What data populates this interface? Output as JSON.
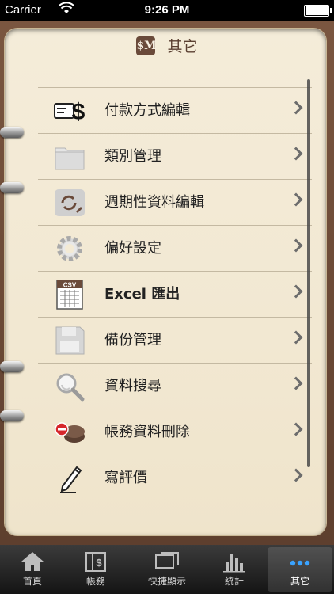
{
  "status_bar": {
    "carrier": "Carrier",
    "time": "9:26 PM"
  },
  "header": {
    "app_icon_text": "$M",
    "title": "其它"
  },
  "menu_items": [
    {
      "label": "付款方式編輯",
      "icon": "payment-method-icon"
    },
    {
      "label": "類別管理",
      "icon": "folder-icon"
    },
    {
      "label": "週期性資料編輯",
      "icon": "recurring-edit-icon"
    },
    {
      "label": "偏好設定",
      "icon": "gear-icon"
    },
    {
      "label": "Excel 匯出",
      "icon": "csv-export-icon"
    },
    {
      "label": "備份管理",
      "icon": "floppy-disk-icon"
    },
    {
      "label": "資料搜尋",
      "icon": "magnifier-icon"
    },
    {
      "label": "帳務資料刪除",
      "icon": "delete-data-icon"
    },
    {
      "label": "寫評價",
      "icon": "pencil-icon"
    }
  ],
  "tabs": [
    {
      "label": "首頁",
      "icon": "home-icon"
    },
    {
      "label": "帳務",
      "icon": "ledger-icon"
    },
    {
      "label": "快捷顯示",
      "icon": "quick-view-icon"
    },
    {
      "label": "統計",
      "icon": "bar-chart-icon"
    },
    {
      "label": "其它",
      "icon": "more-icon",
      "active": true
    }
  ],
  "colors": {
    "paper": "#f3ead5",
    "leather": "#6b4a36",
    "accent_title": "#5a3f31"
  }
}
